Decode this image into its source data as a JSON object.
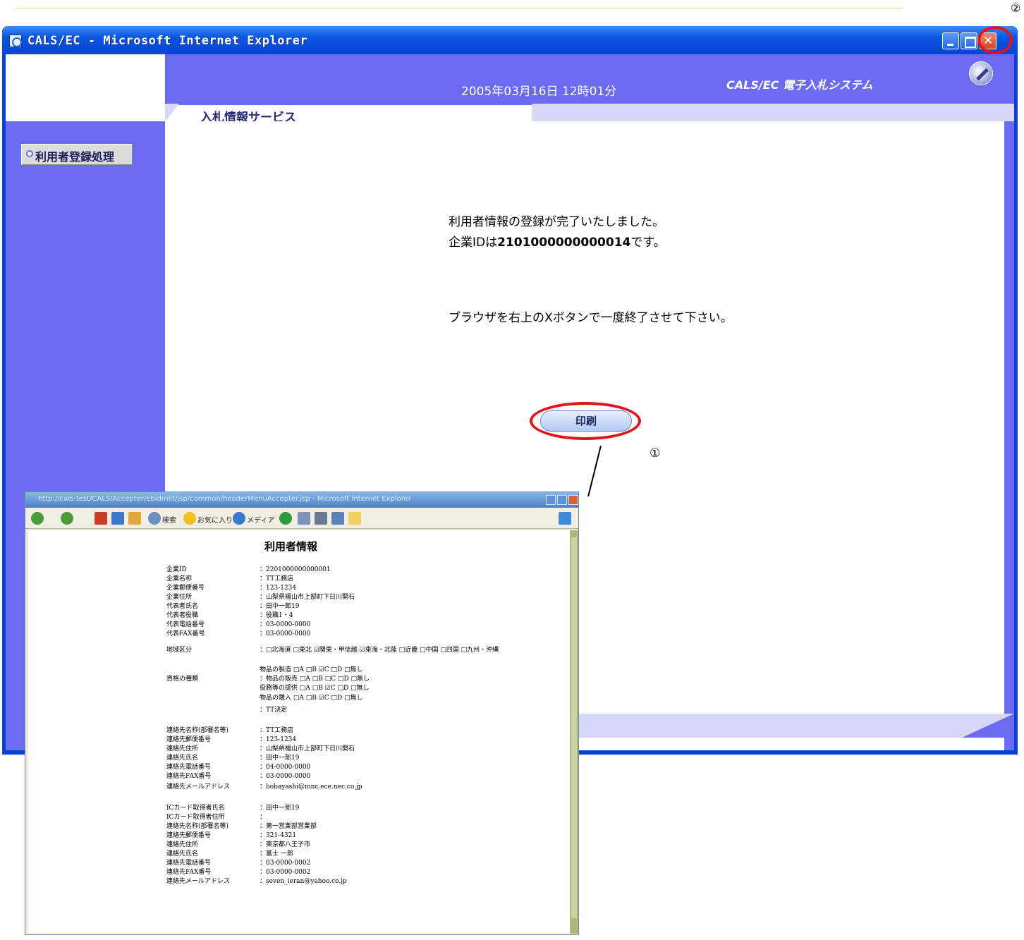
{
  "annotations": {
    "circle_2": "②",
    "circle_1": "①"
  },
  "window": {
    "title": "CALS/EC - Microsoft Internet Explorer",
    "controls": {
      "minimize": "minimize",
      "maximize": "maximize",
      "close": "close"
    }
  },
  "header": {
    "datetime": "2005年03月16日 12時01分",
    "brand": "CALS/EC 電子入札システム",
    "subtitle": "入札情報サービス"
  },
  "sidebar": {
    "items": [
      {
        "label": "利用者登録処理"
      }
    ]
  },
  "main": {
    "message1": "利用者情報の登録が完了いたしました。",
    "message2_prefix": "企業IDは",
    "company_id": "2101000000000014",
    "message2_suffix": "です。",
    "message3": "ブラウザを右上のXボタンで一度終了させて下さい。",
    "print_button": "印刷"
  },
  "preview": {
    "title": "http://cals-test/CALS/Accepter/ebidmlit/jsp/common/headerMenuAccepter.jsp - Microsoft Internet Explorer",
    "toolbar": {
      "search": "検索",
      "favorites": "お気に入り",
      "media": "メディア"
    },
    "doc_title": "利用者情報",
    "rows": [
      {
        "label": "企業ID",
        "value": "：2201000000000001"
      },
      {
        "label": "企業名称",
        "value": "：TT工務店"
      },
      {
        "label": "企業郵便番号",
        "value": "：123-1234"
      },
      {
        "label": "企業住所",
        "value": "：山梨県福山市上部町下日川開石"
      },
      {
        "label": "代表者氏名",
        "value": "：田中一郎19"
      },
      {
        "label": "代表者役職",
        "value": "：役職1・4"
      },
      {
        "label": "代表電話番号",
        "value": "：03-0000-0000"
      },
      {
        "label": "代表FAX番号",
        "value": "：03-0000-0000"
      },
      {
        "label": "地域区分",
        "value": "：□北海道 □東北 ☑関東・甲信越 ☑東海・北陸 □近畿 □中国 □四国 □九州・沖縄"
      },
      {
        "label": "",
        "value": "物品の製造 □A □B ☑C □D □無し"
      },
      {
        "label": "資格の種類",
        "value": "：物品の販売 □A □B □C □D □無し"
      },
      {
        "label": "",
        "value": "役務等の提供 □A □B ☑C □D □無し"
      },
      {
        "label": "",
        "value": "物品の購入 □A □B ☑C □D □無し"
      },
      {
        "label": "",
        "value": "：TT決定"
      },
      {
        "label": "連絡先名称(部署名等)",
        "value": "：TT工務店"
      },
      {
        "label": "連絡先郵便番号",
        "value": "：123-1234"
      },
      {
        "label": "連絡先住所",
        "value": "：山梨県福山市上部町下日川開石"
      },
      {
        "label": "連絡先氏名",
        "value": "：田中一郎19"
      },
      {
        "label": "連絡先電話番号",
        "value": "：04-0000-0000"
      },
      {
        "label": "連絡先FAX番号",
        "value": "：03-0000-0000"
      },
      {
        "label": "連絡先メールアドレス",
        "value": "：bobayashi@mnc.ece.nec.co.jp"
      },
      {
        "label": "ICカード取得者氏名",
        "value": "：田中一郎19"
      },
      {
        "label": "ICカード取得者住所",
        "value": "："
      },
      {
        "label": "連絡先名称(部署名等)",
        "value": "：第一営業部営業部"
      },
      {
        "label": "連絡先郵便番号",
        "value": "：321-4321"
      },
      {
        "label": "連絡先住所",
        "value": "：東京都八王子市"
      },
      {
        "label": "連絡先氏名",
        "value": "：富士 一郎"
      },
      {
        "label": "連絡先電話番号",
        "value": "：03-0000-0002"
      },
      {
        "label": "連絡先FAX番号",
        "value": "：03-0000-0002"
      },
      {
        "label": "連絡先メールアドレス",
        "value": "：seven_ieran@yahoo.co.jp"
      }
    ]
  }
}
